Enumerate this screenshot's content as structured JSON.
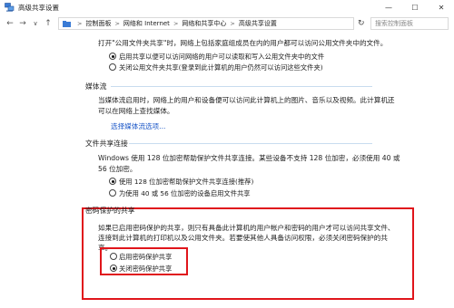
{
  "window": {
    "title": "高级共享设置",
    "minimize_glyph": "—",
    "maximize_glyph": "☐",
    "close_glyph": "✕"
  },
  "nav": {
    "back_glyph": "←",
    "forward_glyph": "→",
    "up_glyph": "↑",
    "dropdown_glyph": "∨",
    "breadcrumbs": [
      "控制面板",
      "网络和 Internet",
      "网络和共享中心",
      "高级共享设置"
    ],
    "separator": ">",
    "refresh_glyph": "↻",
    "search_placeholder": "搜索控制面板"
  },
  "public_folder": {
    "intro": "打开\"公用文件夹共享\"时，网络上包括家庭组成员在内的用户都可以访问公用文件夹中的文件。",
    "options": [
      {
        "label": "启用共享以便可以访问网络的用户可以读取和写入公用文件夹中的文件",
        "selected": true
      },
      {
        "label": "关闭公用文件夹共享(登录到此计算机的用户仍然可以访问这些文件夹)",
        "selected": false
      }
    ]
  },
  "media": {
    "title": "媒体流",
    "line1": "当媒体流启用时，网络上的用户和设备便可以访问此计算机上的图片、音乐以及视频。此计算机还",
    "line2": "可以在网络上查找媒体。",
    "link": "选择媒体流选项..."
  },
  "file_sharing": {
    "title": "文件共享连接",
    "line1": "Windows 使用 128 位加密帮助保护文件共享连接。某些设备不支持 128 位加密，必须使用 40 或",
    "line2": "56 位加密。",
    "options": [
      {
        "label": "使用 128 位加密帮助保护文件共享连接(推荐)",
        "selected": true
      },
      {
        "label": "为使用 40 或 56 位加密的设备启用文件共享",
        "selected": false
      }
    ]
  },
  "password": {
    "title": "密码保护的共享",
    "line1": "如果已启用密码保护的共享，则只有具备此计算机的用户帐户和密码的用户才可以访问共享文件、",
    "line2": "连接到此计算机的打印机以及公用文件夹。若要使其他人具备访问权限，必须关闭密码保护的共",
    "line3": "享。",
    "options": [
      {
        "label": "启用密码保护共享",
        "selected": false
      },
      {
        "label": "关闭密码保护共享",
        "selected": true
      }
    ]
  },
  "colors": {
    "highlight_border": "#e0151b",
    "link": "#1a56c7"
  }
}
